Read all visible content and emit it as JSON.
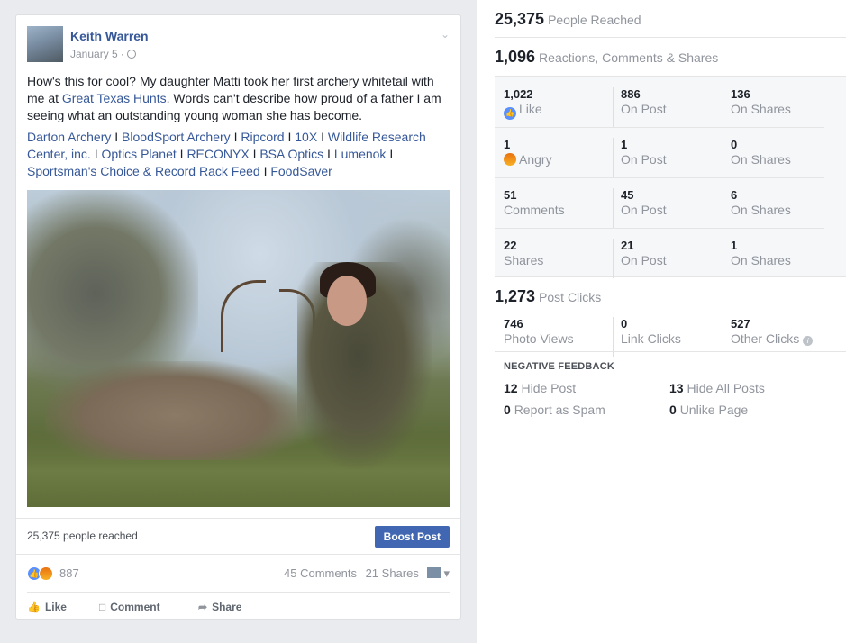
{
  "post": {
    "author": "Keith Warren",
    "date": "January 5",
    "text_before": "How's this for cool? My daughter Matti took her first archery whitetail with me at ",
    "text_link": "Great Texas Hunts",
    "text_after": ". Words can't describe how proud of a father I am seeing what an outstanding young woman she has become.",
    "tags": [
      "Darton Archery",
      "BloodSport Archery",
      "Ripcord",
      "10X",
      "Wildlife Research Center, inc.",
      "Optics Planet",
      "RECONYX",
      "BSA Optics",
      "Lumenok",
      "Sportsman's Choice & Record Rack Feed",
      "FoodSaver"
    ],
    "tag_separator": "I",
    "reached_text": "25,375 people reached",
    "boost_label": "Boost Post",
    "reactions_count": "887",
    "comments_text": "45 Comments",
    "shares_text": "21 Shares",
    "actions": {
      "like": "Like",
      "comment": "Comment",
      "share": "Share"
    }
  },
  "insights": {
    "people_reached": {
      "value": "25,375",
      "label": "People Reached"
    },
    "engagement": {
      "value": "1,096",
      "label": "Reactions, Comments & Shares"
    },
    "grid": [
      [
        {
          "value": "1,022",
          "label": "Like"
        },
        {
          "value": "886",
          "label": "On Post"
        },
        {
          "value": "136",
          "label": "On Shares"
        }
      ],
      [
        {
          "value": "1",
          "label": "Angry"
        },
        {
          "value": "1",
          "label": "On Post"
        },
        {
          "value": "0",
          "label": "On Shares"
        }
      ],
      [
        {
          "value": "51",
          "label": "Comments"
        },
        {
          "value": "45",
          "label": "On Post"
        },
        {
          "value": "6",
          "label": "On Shares"
        }
      ],
      [
        {
          "value": "22",
          "label": "Shares"
        },
        {
          "value": "21",
          "label": "On Post"
        },
        {
          "value": "1",
          "label": "On Shares"
        }
      ]
    ],
    "post_clicks": {
      "value": "1,273",
      "label": "Post Clicks"
    },
    "clicks": [
      {
        "value": "746",
        "label": "Photo Views"
      },
      {
        "value": "0",
        "label": "Link Clicks"
      },
      {
        "value": "527",
        "label": "Other Clicks"
      }
    ],
    "negative_title": "NEGATIVE FEEDBACK",
    "negative": [
      {
        "value": "12",
        "label": "Hide Post"
      },
      {
        "value": "13",
        "label": "Hide All Posts"
      },
      {
        "value": "0",
        "label": "Report as Spam"
      },
      {
        "value": "0",
        "label": "Unlike Page"
      }
    ]
  },
  "colors": {
    "link": "#365899",
    "boost": "#4267b2",
    "muted": "#90949c",
    "like_blue": "#5890ff"
  }
}
